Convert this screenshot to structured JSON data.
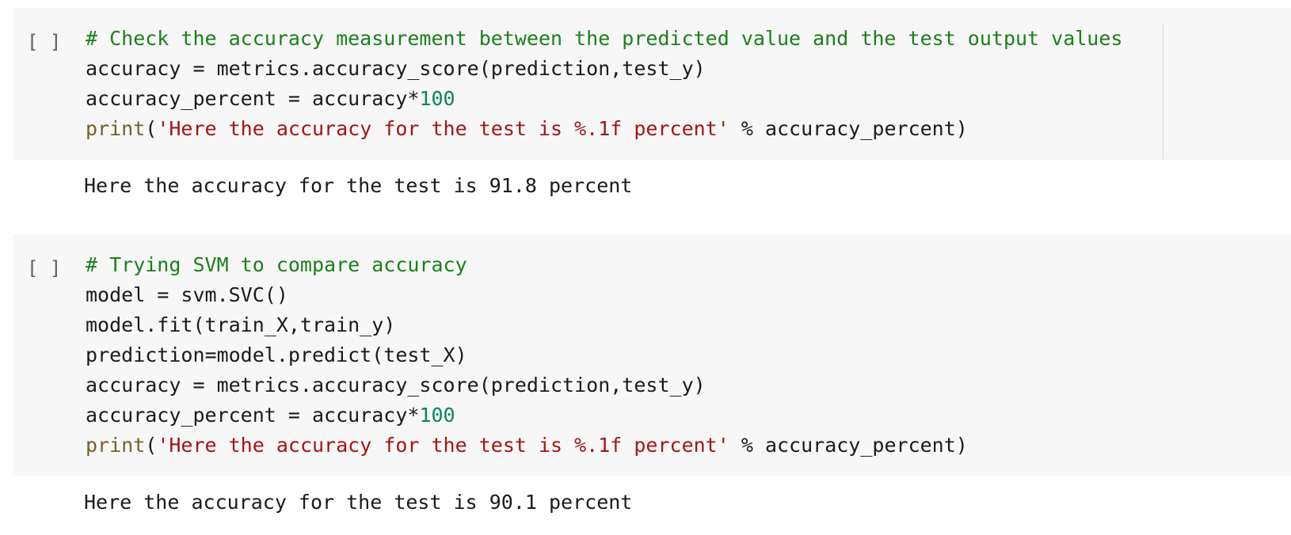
{
  "cells": [
    {
      "run_indicator": "[ ]",
      "code": {
        "line1_comment": "# Check the accuracy measurement between the predicted value and the test output values",
        "line2": "accuracy = metrics.accuracy_score(prediction,test_y)",
        "line3_pre": "accuracy_percent = accuracy*",
        "line3_num": "100",
        "line4_fn": "print",
        "line4_open": "(",
        "line4_str": "'Here the accuracy for the test is %.1f percent'",
        "line4_post": " % accuracy_percent)"
      },
      "output": "Here the accuracy for the test is 91.8 percent"
    },
    {
      "run_indicator": "[ ]",
      "code": {
        "line1_comment": "# Trying SVM to compare accuracy",
        "line2": "model = svm.SVC()",
        "line3": "model.fit(train_X,train_y)",
        "line4": "prediction=model.predict(test_X)",
        "line5": "accuracy = metrics.accuracy_score(prediction,test_y)",
        "line6_pre": "accuracy_percent = accuracy*",
        "line6_num": "100",
        "line7_fn": "print",
        "line7_open": "(",
        "line7_str": "'Here the accuracy for the test is %.1f percent'",
        "line7_post": " % accuracy_percent)"
      },
      "output": "Here the accuracy for the test is 90.1 percent"
    }
  ],
  "colors": {
    "cell_background": "#f7f7f7",
    "comment": "#1a801a",
    "string": "#a31515",
    "number": "#098658",
    "builtin": "#795e26",
    "text": "#1a1a1a"
  }
}
